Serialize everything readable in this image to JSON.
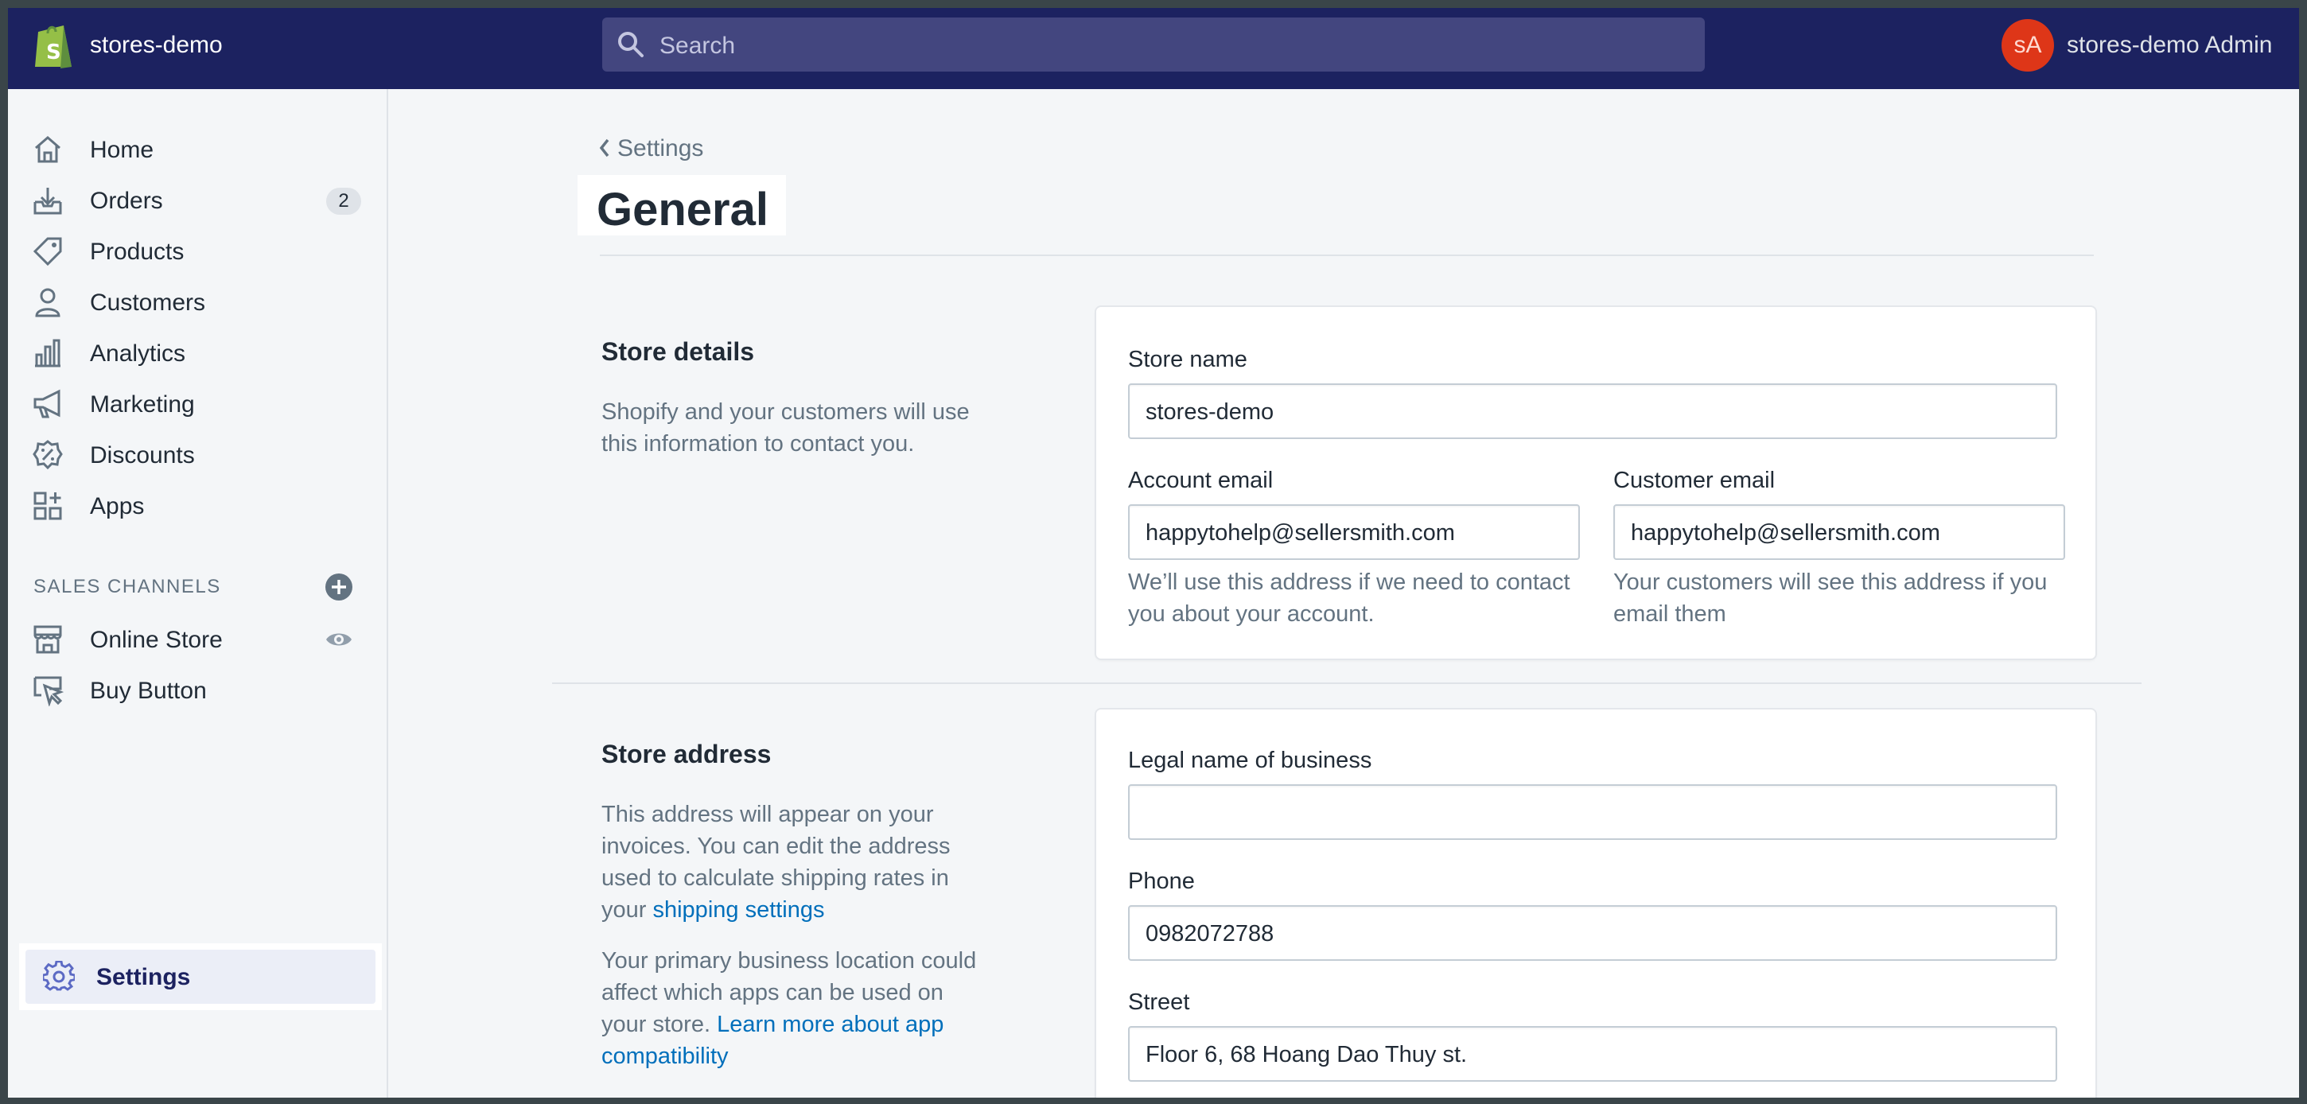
{
  "topbar": {
    "store_name": "stores-demo",
    "search_placeholder": "Search",
    "avatar_initials": "sA",
    "admin_name": "stores-demo Admin"
  },
  "sidebar": {
    "items": [
      {
        "label": "Home",
        "icon": "home-icon"
      },
      {
        "label": "Orders",
        "icon": "orders-icon",
        "badge": "2"
      },
      {
        "label": "Products",
        "icon": "tag-icon"
      },
      {
        "label": "Customers",
        "icon": "person-icon"
      },
      {
        "label": "Analytics",
        "icon": "bar-chart-icon"
      },
      {
        "label": "Marketing",
        "icon": "megaphone-icon"
      },
      {
        "label": "Discounts",
        "icon": "discount-icon"
      },
      {
        "label": "Apps",
        "icon": "apps-icon"
      }
    ],
    "sales_channels_title": "SALES CHANNELS",
    "channels": [
      {
        "label": "Online Store",
        "icon": "store-icon"
      },
      {
        "label": "Buy Button",
        "icon": "buy-button-icon"
      }
    ],
    "settings_label": "Settings"
  },
  "main": {
    "breadcrumb": "Settings",
    "title": "General",
    "store_details": {
      "title": "Store details",
      "description": "Shopify and your customers will use this information to contact you.",
      "store_name_label": "Store name",
      "store_name_value": "stores-demo",
      "account_email_label": "Account email",
      "account_email_value": "happytohelp@sellersmith.com",
      "account_email_help": "We’ll use this address if we need to contact you about your account.",
      "customer_email_label": "Customer email",
      "customer_email_value": "happytohelp@sellersmith.com",
      "customer_email_help": "Your customers will see this address if you email them"
    },
    "store_address": {
      "title": "Store address",
      "description_1": "This address will appear on your invoices. You can edit the address used to calculate shipping rates in your ",
      "shipping_link": "shipping settings",
      "description_2": "Your primary business location could affect which apps can be used on your store. ",
      "learn_more_link": "Learn more about app compatibility",
      "legal_name_label": "Legal name of business",
      "legal_name_value": "",
      "phone_label": "Phone",
      "phone_value": "0982072788",
      "street_label": "Street",
      "street_value": "Floor 6, 68 Hoang Dao Thuy st."
    }
  },
  "colors": {
    "topbar": "#1c2260",
    "search_bg": "#43467f",
    "avatar": "#de3618",
    "link": "#006fbb",
    "text_muted": "#637381"
  }
}
